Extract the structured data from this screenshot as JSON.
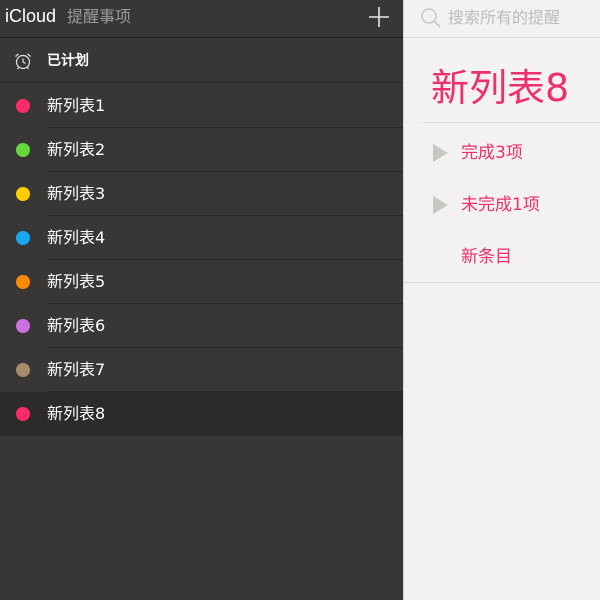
{
  "header": {
    "brand": "iCloud",
    "app_name": "提醒事项",
    "add_icon": "plus-icon"
  },
  "sidebar": {
    "scheduled": {
      "label": "已计划",
      "icon": "alarm-clock-icon"
    },
    "lists": [
      {
        "label": "新列表1",
        "color": "#fb2b69"
      },
      {
        "label": "新列表2",
        "color": "#62d83a"
      },
      {
        "label": "新列表3",
        "color": "#ffcc00"
      },
      {
        "label": "新列表4",
        "color": "#1aa7f2"
      },
      {
        "label": "新列表5",
        "color": "#fe8a09"
      },
      {
        "label": "新列表6",
        "color": "#cc72e0"
      },
      {
        "label": "新列表7",
        "color": "#a78c6b"
      },
      {
        "label": "新列表8",
        "color": "#fb2b69",
        "selected": true
      }
    ]
  },
  "search": {
    "placeholder": "搜索所有的提醒",
    "icon": "search-icon"
  },
  "main": {
    "title": "新列表8",
    "groups": [
      {
        "label": "完成3项"
      },
      {
        "label": "未完成1项"
      }
    ],
    "new_item_label": "新条目",
    "accent_color": "#ee2f6e"
  }
}
